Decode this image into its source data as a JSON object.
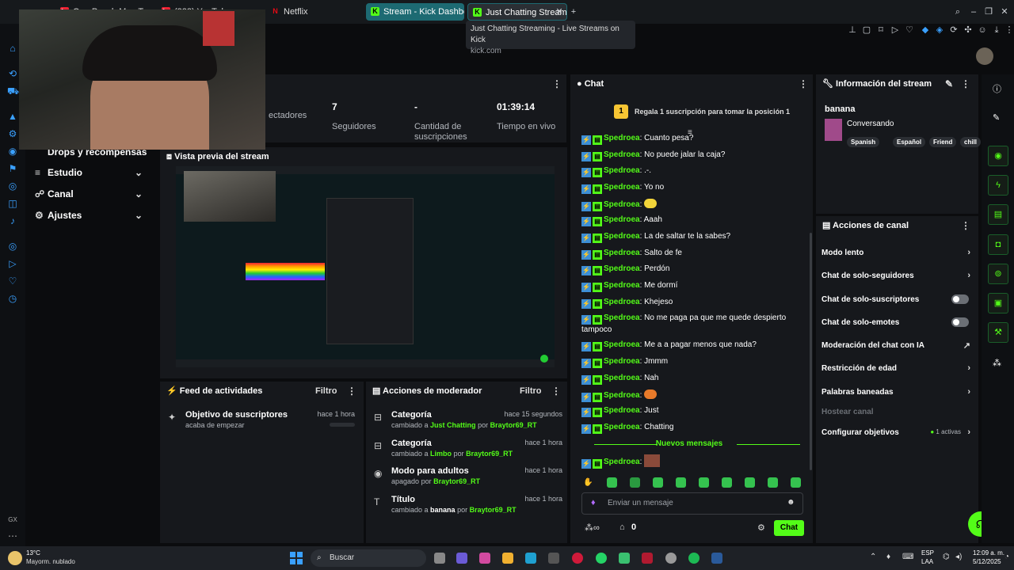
{
  "browser": {
    "tabs": [
      {
        "label": "One Punch Man Tempor"
      },
      {
        "label": "(222) YouTube"
      },
      {
        "label": "Netflix"
      },
      {
        "label": "Stream - Kick Dashboard"
      },
      {
        "label": "Just Chatting Stream"
      }
    ],
    "tooltip": {
      "title": "Just Chatting Streaming - Live Streams on Kick",
      "url": "kick.com"
    }
  },
  "sidebar": {
    "items": [
      {
        "label": "Drops y recompensas"
      },
      {
        "label": "Estudio"
      },
      {
        "label": "Canal"
      },
      {
        "label": "Ajustes"
      }
    ]
  },
  "stats": [
    {
      "value": "",
      "label": "ectadores"
    },
    {
      "value": "7",
      "label": "Seguidores"
    },
    {
      "value": "-",
      "label": "Cantidad de suscripciones"
    },
    {
      "value": "01:39:14",
      "label": "Tiempo en vivo"
    }
  ],
  "preview": {
    "title": "Vista previa del stream"
  },
  "feed": {
    "title": "Feed de actividades",
    "filter": "Filtro",
    "items": [
      {
        "title": "Objetivo de suscriptores",
        "sub": "acaba de empezar",
        "time": "hace 1 hora"
      }
    ]
  },
  "mod_actions": {
    "title": "Acciones de moderador",
    "filter": "Filtro",
    "items": [
      {
        "title": "Categoría",
        "sub_prefix": "cambiado a",
        "value": "Just Chatting",
        "by": "por",
        "user": "Braytor69_RT",
        "time": "hace 15 segundos"
      },
      {
        "title": "Categoría",
        "sub_prefix": "cambiado a",
        "value": "Limbo",
        "by": "por",
        "user": "Braytor69_RT",
        "time": "hace 1 hora"
      },
      {
        "title": "Modo para adultos",
        "sub_prefix": "apagado",
        "value": "",
        "by": "por",
        "user": "Braytor69_RT",
        "time": "hace 1 hora"
      },
      {
        "title": "Título",
        "sub_prefix": "cambiado a",
        "value": "banana",
        "by": "por",
        "user": "Braytor69_RT",
        "time": "hace 1 hora"
      }
    ]
  },
  "chat": {
    "title": "Chat",
    "goal": "Regala 1 suscripción para tomar la posición 1",
    "goal_rank": "1",
    "username": "Spedroea",
    "messages": [
      "Cuanto pesa?",
      "No puede jalar la caja?",
      ".-.",
      "Yo no",
      "",
      "Aaah",
      "La de saltar te la sabes?",
      "Salto de fe",
      "Perdón",
      "Me dormí",
      "Khejeso",
      "No me paga pa que me quede despierto tampoco",
      "Me a a pagar menos que nada?",
      "Jmmm",
      "Nah",
      "",
      "Just",
      "Chatting"
    ],
    "new_messages_label": "Nuevos mensajes",
    "last_message": "",
    "input_placeholder": "Enviar un mensaje",
    "points": "0",
    "send_label": "Chat"
  },
  "stream_info": {
    "title": "Información del stream",
    "stream_title": "banana",
    "category": "Conversando",
    "tags": [
      "Spanish",
      "Español",
      "Friend",
      "chill"
    ]
  },
  "channel_actions": {
    "title": "Acciones de canal",
    "items": [
      {
        "label": "Modo lento",
        "control": "chevron"
      },
      {
        "label": "Chat de solo-seguidores",
        "control": "chevron"
      },
      {
        "label": "Chat de solo-suscriptores",
        "control": "toggle",
        "on": false
      },
      {
        "label": "Chat de solo-emotes",
        "control": "toggle",
        "on": false
      },
      {
        "label": "Moderación del chat con IA",
        "control": "external"
      },
      {
        "label": "Restricción de edad",
        "control": "chevron"
      },
      {
        "label": "Palabras baneadas",
        "control": "chevron"
      },
      {
        "label": "Hostear canal",
        "control": "none"
      },
      {
        "label": "Configurar objetivos",
        "control": "chevron",
        "extra": "1 activas"
      }
    ]
  },
  "taskbar": {
    "weather_temp": "13°C",
    "weather_desc": "Mayorm. nublado",
    "search": "Buscar",
    "lang": "ESP",
    "lang2": "LAA",
    "time": "12:09 a. m.",
    "date": "5/12/2025"
  },
  "colors": {
    "accent": "#53fc18",
    "panel": "#16181c",
    "bg": "#0b0c0e"
  }
}
